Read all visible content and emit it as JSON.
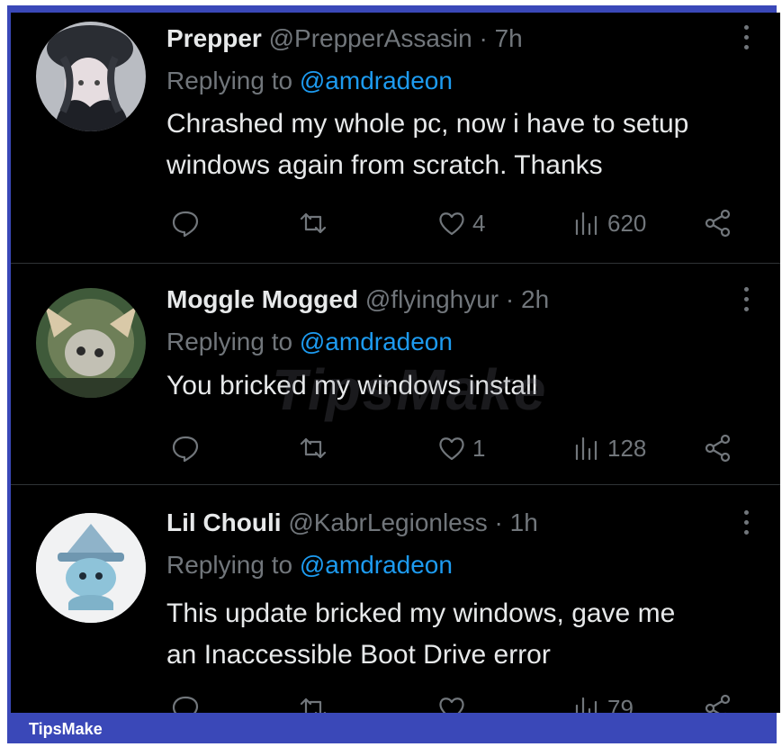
{
  "tweets": [
    {
      "name": "Prepper",
      "handle": "@PrepperAssasin",
      "dot": "·",
      "time": "7h",
      "replying_prefix": "Replying to",
      "replying_to": "@amdradeon",
      "text_lines": [
        "Chrashed my whole pc, now i have to setup",
        "windows again from scratch. Thanks"
      ],
      "likes": "4",
      "views": "620"
    },
    {
      "name": "Moggle Mogged",
      "handle": "@flyinghyur",
      "dot": "·",
      "time": "2h",
      "replying_prefix": "Replying to",
      "replying_to": "@amdradeon",
      "text_lines": [
        "You bricked my windows install"
      ],
      "likes": "1",
      "views": "128"
    },
    {
      "name": "Lil Chouli",
      "handle": "@KabrLegionless",
      "dot": "·",
      "time": "1h",
      "replying_prefix": "Replying to",
      "replying_to": "@amdradeon",
      "text_lines": [
        "This update bricked my windows, gave me",
        "an Inaccessible Boot Drive error"
      ],
      "likes": "",
      "views": "79"
    }
  ],
  "icons": [
    "reply-icon",
    "retweet-icon",
    "like-icon",
    "views-icon",
    "share-icon",
    "more-icon"
  ],
  "colors": {
    "background": "#000000",
    "text": "#e7e9ea",
    "muted": "#71767b",
    "mention": "#1d9bf0",
    "frame": "#3a48b8"
  },
  "watermark": "TipsMake",
  "footer": {
    "brand": "TipsMake"
  }
}
